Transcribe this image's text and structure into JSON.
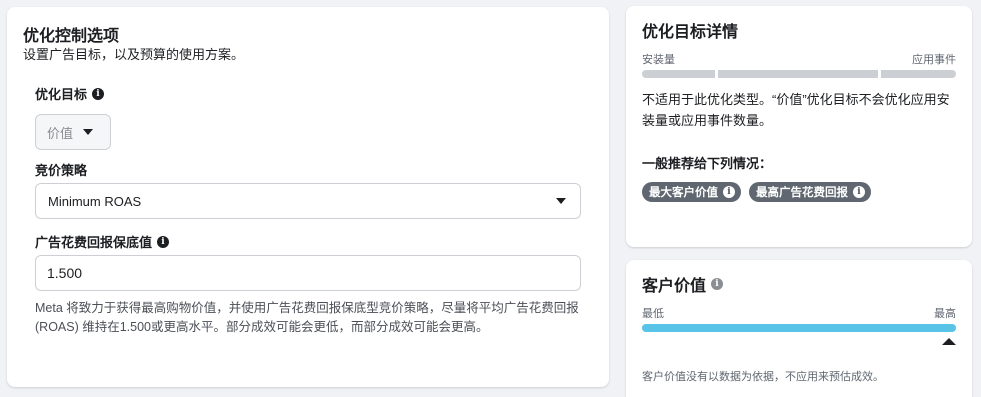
{
  "optimization_controls": {
    "title": "优化控制选项",
    "subtitle": "设置广告目标，以及预算的使用方案。",
    "goal_label": "优化目标",
    "goal_value": "价值",
    "bid_strategy_label": "竞价策略",
    "bid_strategy_value": "Minimum ROAS",
    "roas_floor_label": "广告花费回报保底值",
    "roas_floor_value": "1.500",
    "help_text": "Meta 将致力于获得最高购物价值，并使用广告花费回报保底型竞价策略，尽量将平均广告花费回报 (ROAS) 维持在1.500或更高水平。部分成效可能会更低，而部分成效可能会更高。"
  },
  "goal_details": {
    "title": "优化目标详情",
    "scale_left": "安装量",
    "scale_right": "应用事件",
    "description": "不适用于此优化类型。“价值”优化目标不会优化应用安装量或应用事件数量。",
    "recommended_label": "一般推荐给下列情况：",
    "tags": [
      "最大客户价值",
      "最高广告花费回报"
    ]
  },
  "customer_value": {
    "title": "客户价值",
    "scale_left": "最低",
    "scale_right": "最高",
    "level": 1.0,
    "footnote": "客户价值没有以数据为依据，不应用来预估成效。"
  },
  "colors": {
    "accent_bar": "#57c4e8",
    "pill_bg": "#606770",
    "segment_bg": "#ccd0d5"
  },
  "icons": {
    "info": "info-icon",
    "dropdown": "caret-down-icon",
    "indicator": "caret-up-icon"
  }
}
